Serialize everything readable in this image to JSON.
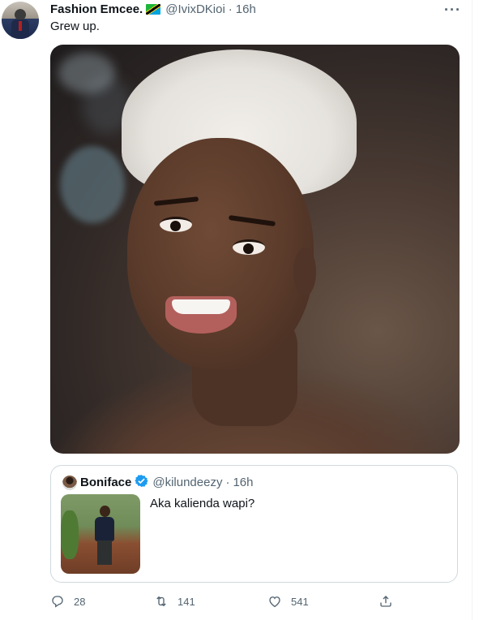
{
  "tweet": {
    "author_name": "Fashion Emcee.",
    "author_handle": "@IvixDKioi",
    "separator": "·",
    "time": "16h",
    "more_label": "···",
    "text": "Grew up."
  },
  "quoted_tweet": {
    "author_name": "Boniface",
    "author_handle": "@kilundeezy",
    "separator": "·",
    "time": "16h",
    "text": "Aka kalienda wapi?"
  },
  "actions": {
    "replies": "28",
    "retweets": "141",
    "likes": "541"
  },
  "icons": {
    "reply": "reply-icon",
    "retweet": "retweet-icon",
    "like": "heart-icon",
    "share": "share-icon",
    "verified": "verified-badge-icon",
    "more": "more-icon"
  },
  "colors": {
    "text_primary": "#0f1419",
    "text_secondary": "#536471",
    "verified_blue": "#1d9bf0",
    "border": "#cfd9de"
  }
}
